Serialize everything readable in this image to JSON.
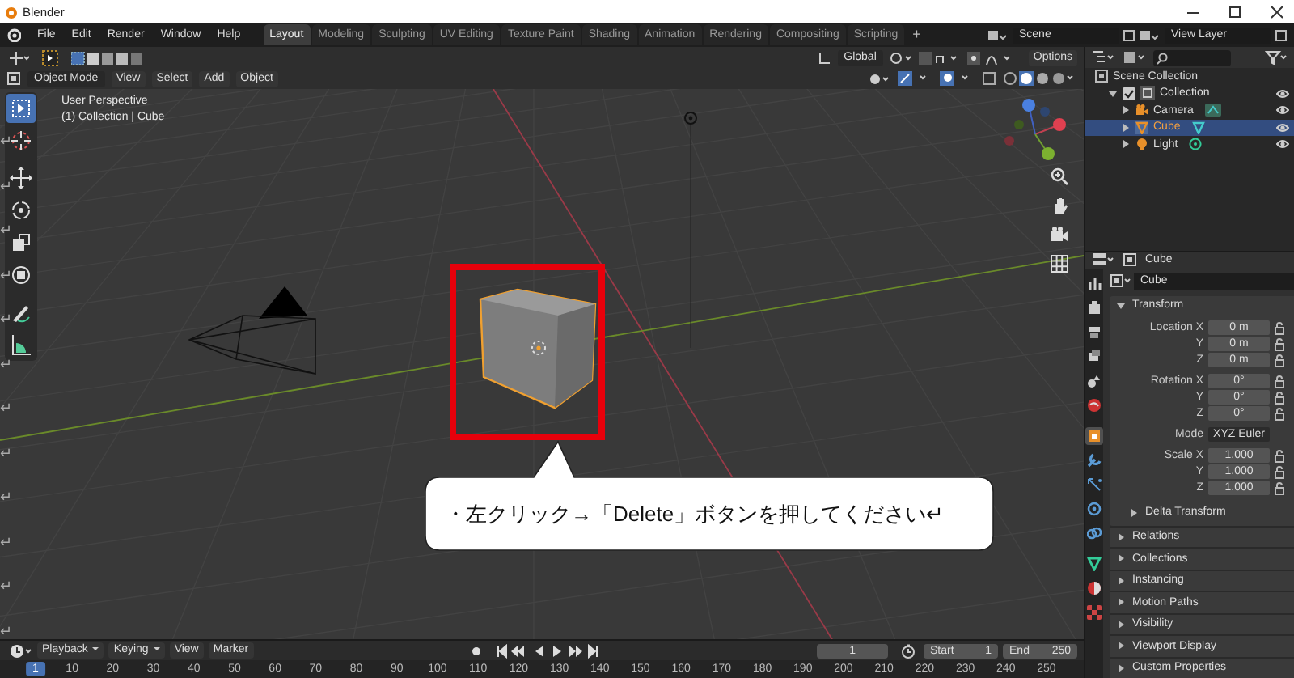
{
  "window": {
    "title": "Blender"
  },
  "menu": [
    "File",
    "Edit",
    "Render",
    "Window",
    "Help"
  ],
  "workspaces": [
    {
      "label": "Layout",
      "selected": true
    },
    {
      "label": "Modeling",
      "selected": false
    },
    {
      "label": "Sculpting",
      "selected": false
    },
    {
      "label": "UV Editing",
      "selected": false
    },
    {
      "label": "Texture Paint",
      "selected": false
    },
    {
      "label": "Shading",
      "selected": false
    },
    {
      "label": "Animation",
      "selected": false
    },
    {
      "label": "Rendering",
      "selected": false
    },
    {
      "label": "Compositing",
      "selected": false
    },
    {
      "label": "Scripting",
      "selected": false
    }
  ],
  "add_workspace": "+",
  "scene": "Scene",
  "view_layer": "View Layer",
  "tool_header": {
    "orientation": "Global",
    "options": "Options"
  },
  "viewport_header": {
    "mode": "Object Mode",
    "menus": [
      "View",
      "Select",
      "Add",
      "Object"
    ]
  },
  "viewport": {
    "view_name": "User Perspective",
    "collection_info": "(1) Collection | Cube"
  },
  "paragraph_marks": [
    "↵",
    "↵",
    "↵",
    "↵",
    "↵",
    "↵",
    "↵",
    "↵",
    "↵",
    "↵",
    "↵",
    "↵"
  ],
  "callout": {
    "text": "・左クリック→「Delete」ボタンを押してください↵"
  },
  "outliner": {
    "root": "Scene Collection",
    "collections": [
      {
        "label": "Collection",
        "checked": true,
        "expanded": true,
        "children": [
          {
            "label": "Camera",
            "kind": "camera",
            "selected": false
          },
          {
            "label": "Cube",
            "kind": "mesh",
            "selected": true
          },
          {
            "label": "Light",
            "kind": "light",
            "selected": false
          }
        ]
      }
    ]
  },
  "properties": {
    "object_name": "Cube",
    "data_name": "Cube",
    "tabs": [
      {
        "kind": "tool",
        "selected": false
      },
      {
        "kind": "render",
        "selected": false
      },
      {
        "kind": "output",
        "selected": false
      },
      {
        "kind": "view_layer",
        "selected": false
      },
      {
        "kind": "scene",
        "selected": false
      },
      {
        "kind": "world",
        "selected": false
      },
      {
        "kind": "object",
        "selected": true
      },
      {
        "kind": "modifiers",
        "selected": false
      },
      {
        "kind": "particles",
        "selected": false
      },
      {
        "kind": "physics",
        "selected": false
      },
      {
        "kind": "constraints",
        "selected": false
      },
      {
        "kind": "data",
        "selected": false
      },
      {
        "kind": "material",
        "selected": false
      },
      {
        "kind": "texture",
        "selected": false
      }
    ],
    "transform": {
      "title": "Transform",
      "groups": [
        [
          {
            "label": "Location X",
            "value": "0 m",
            "kind": "number"
          },
          {
            "label": "Y",
            "value": "0 m",
            "kind": "number"
          },
          {
            "label": "Z",
            "value": "0 m",
            "kind": "number"
          }
        ],
        [
          {
            "label": "Rotation X",
            "value": "0°",
            "kind": "number"
          },
          {
            "label": "Y",
            "value": "0°",
            "kind": "number"
          },
          {
            "label": "Z",
            "value": "0°",
            "kind": "number"
          }
        ],
        [
          {
            "label": "Mode",
            "value": "XYZ Euler",
            "kind": "dropdown"
          }
        ],
        [
          {
            "label": "Scale X",
            "value": "1.000",
            "kind": "number"
          },
          {
            "label": "Y",
            "value": "1.000",
            "kind": "number"
          },
          {
            "label": "Z",
            "value": "1.000",
            "kind": "number"
          }
        ]
      ],
      "subpanel": "Delta Transform"
    },
    "sections": [
      "Relations",
      "Collections",
      "Instancing",
      "Motion Paths",
      "Visibility",
      "Viewport Display",
      "Custom Properties"
    ]
  },
  "timeline": {
    "menus": [
      {
        "label": "Playback",
        "dropdown": true
      },
      {
        "label": "Keying",
        "dropdown": true
      },
      {
        "label": "View",
        "dropdown": false
      },
      {
        "label": "Marker",
        "dropdown": false
      }
    ],
    "current_frame": "1",
    "start_label": "Start",
    "start": "1",
    "end_label": "End",
    "end": "250",
    "ruler": [
      {
        "label": "1",
        "selected": true
      },
      {
        "label": "10",
        "selected": false
      },
      {
        "label": "20",
        "selected": false
      },
      {
        "label": "30",
        "selected": false
      },
      {
        "label": "40",
        "selected": false
      },
      {
        "label": "50",
        "selected": false
      },
      {
        "label": "60",
        "selected": false
      },
      {
        "label": "70",
        "selected": false
      },
      {
        "label": "80",
        "selected": false
      },
      {
        "label": "90",
        "selected": false
      },
      {
        "label": "100",
        "selected": false
      },
      {
        "label": "110",
        "selected": false
      },
      {
        "label": "120",
        "selected": false
      },
      {
        "label": "130",
        "selected": false
      },
      {
        "label": "140",
        "selected": false
      },
      {
        "label": "150",
        "selected": false
      },
      {
        "label": "160",
        "selected": false
      },
      {
        "label": "170",
        "selected": false
      },
      {
        "label": "180",
        "selected": false
      },
      {
        "label": "190",
        "selected": false
      },
      {
        "label": "200",
        "selected": false
      },
      {
        "label": "210",
        "selected": false
      },
      {
        "label": "220",
        "selected": false
      },
      {
        "label": "230",
        "selected": false
      },
      {
        "label": "240",
        "selected": false
      },
      {
        "label": "250",
        "selected": false
      }
    ]
  }
}
